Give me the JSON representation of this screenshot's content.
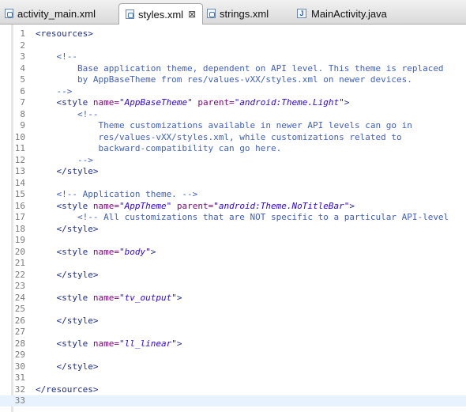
{
  "tabs": [
    {
      "label": "activity_main.xml",
      "active": false,
      "icon": "xml-file-icon"
    },
    {
      "label": "styles.xml",
      "active": true,
      "icon": "xml-file-icon",
      "close_glyph": "⊠"
    },
    {
      "label": "strings.xml",
      "active": false,
      "icon": "xml-file-icon"
    },
    {
      "label": "MainActivity.java",
      "active": false,
      "icon": "java-file-icon",
      "icon_letter": "J"
    }
  ],
  "colors": {
    "tag": "#1f2f8a",
    "attribute": "#7f007f",
    "value": "#2a00ff",
    "comment": "#3f5fbf",
    "current_line": "#e8f2fe"
  },
  "editor": {
    "current_line": 33,
    "lines": [
      [
        {
          "t": "tag",
          "x": "<resources>"
        }
      ],
      [],
      [
        {
          "t": "com",
          "x": "    <!--"
        }
      ],
      [
        {
          "t": "com",
          "x": "        Base application theme, dependent on API level. This theme is replaced"
        }
      ],
      [
        {
          "t": "com",
          "x": "        by AppBaseTheme from res/values-vXX/styles.xml on newer devices."
        }
      ],
      [
        {
          "t": "com",
          "x": "    -->"
        }
      ],
      [
        {
          "t": "tag",
          "x": "    <style "
        },
        {
          "t": "attr",
          "x": "name="
        },
        {
          "t": "val",
          "x": "\"AppBaseTheme\""
        },
        {
          "t": "tag",
          "x": " "
        },
        {
          "t": "attr",
          "x": "parent="
        },
        {
          "t": "val",
          "x": "\"android:Theme.Light\""
        },
        {
          "t": "tag",
          "x": ">"
        }
      ],
      [
        {
          "t": "com",
          "x": "        <!--"
        }
      ],
      [
        {
          "t": "com",
          "x": "            Theme customizations available in newer API levels can go in"
        }
      ],
      [
        {
          "t": "com",
          "x": "            res/values-vXX/styles.xml, while customizations related to"
        }
      ],
      [
        {
          "t": "com",
          "x": "            backward-compatibility can go here."
        }
      ],
      [
        {
          "t": "com",
          "x": "        -->"
        }
      ],
      [
        {
          "t": "tag",
          "x": "    </style>"
        }
      ],
      [],
      [
        {
          "t": "com",
          "x": "    <!-- Application theme. -->"
        }
      ],
      [
        {
          "t": "tag",
          "x": "    <style "
        },
        {
          "t": "attr",
          "x": "name="
        },
        {
          "t": "val",
          "x": "\"AppTheme\""
        },
        {
          "t": "tag",
          "x": " "
        },
        {
          "t": "attr",
          "x": "parent="
        },
        {
          "t": "val",
          "x": "\"android:Theme.NoTitleBar\""
        },
        {
          "t": "tag",
          "x": ">"
        }
      ],
      [
        {
          "t": "com",
          "x": "        <!-- All customizations that are NOT specific to a particular API-level"
        }
      ],
      [
        {
          "t": "tag",
          "x": "    </style>"
        }
      ],
      [],
      [
        {
          "t": "tag",
          "x": "    <style "
        },
        {
          "t": "attr",
          "x": "name="
        },
        {
          "t": "val",
          "x": "\"body\""
        },
        {
          "t": "tag",
          "x": ">"
        }
      ],
      [],
      [
        {
          "t": "tag",
          "x": "    </style>"
        }
      ],
      [],
      [
        {
          "t": "tag",
          "x": "    <style "
        },
        {
          "t": "attr",
          "x": "name="
        },
        {
          "t": "val",
          "x": "\"tv_output\""
        },
        {
          "t": "tag",
          "x": ">"
        }
      ],
      [],
      [
        {
          "t": "tag",
          "x": "    </style>"
        }
      ],
      [],
      [
        {
          "t": "tag",
          "x": "    <style "
        },
        {
          "t": "attr",
          "x": "name="
        },
        {
          "t": "val",
          "x": "\"ll_linear\""
        },
        {
          "t": "tag",
          "x": ">"
        }
      ],
      [],
      [
        {
          "t": "tag",
          "x": "    </style>"
        }
      ],
      [],
      [
        {
          "t": "tag",
          "x": "</resources>"
        }
      ],
      []
    ]
  }
}
